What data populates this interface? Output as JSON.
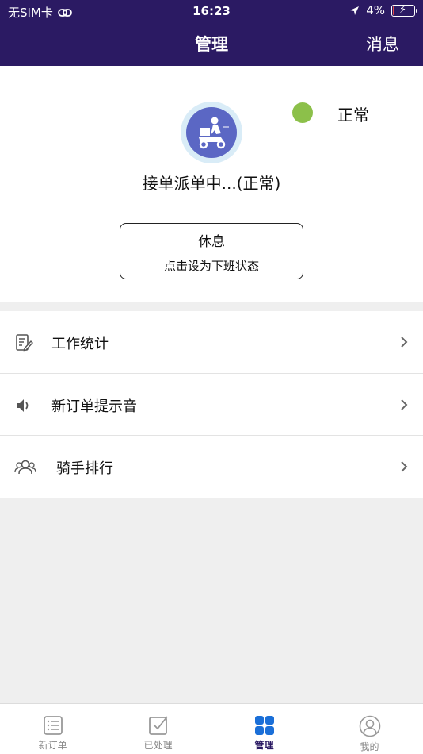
{
  "status_bar": {
    "carrier": "无SIM卡",
    "time": "16:23",
    "battery": "4%",
    "battery_level": 0.04
  },
  "nav": {
    "title": "管理",
    "right_action": "消息"
  },
  "rider": {
    "status": "正常",
    "status_color": "#8cc04a",
    "dispatch_text": "接单派单中...(正常)",
    "rest_button": {
      "title": "休息",
      "subtitle": "点击设为下班状态"
    }
  },
  "menu": [
    {
      "label": "工作统计",
      "icon": "document-edit-icon"
    },
    {
      "label": "新订单提示音",
      "icon": "speaker-icon"
    },
    {
      "label": "骑手排行",
      "icon": "users-icon"
    }
  ],
  "tabs": [
    {
      "label": "新订单",
      "icon": "list-icon",
      "active": false
    },
    {
      "label": "已处理",
      "icon": "checked-box-icon",
      "active": false
    },
    {
      "label": "管理",
      "icon": "grid-icon",
      "active": true
    },
    {
      "label": "我的",
      "icon": "person-icon",
      "active": false
    }
  ],
  "colors": {
    "brand": "#2b1a63",
    "accent": "#1a6fd8",
    "background": "#efefef"
  }
}
